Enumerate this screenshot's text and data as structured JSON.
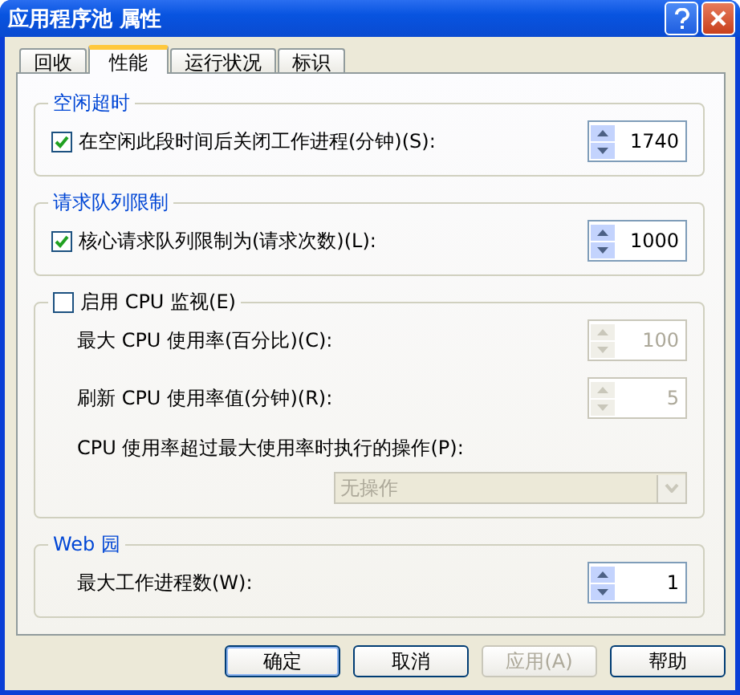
{
  "window": {
    "title": "应用程序池 属性"
  },
  "tabs": [
    {
      "label": "回收",
      "selected": false
    },
    {
      "label": "性能",
      "selected": true
    },
    {
      "label": "运行状况",
      "selected": false
    },
    {
      "label": "标识",
      "selected": false
    }
  ],
  "groups": [
    {
      "kind": "titled",
      "title": "空闲超时",
      "rows": [
        {
          "kind": "check-spin",
          "label": "在空闲此段时间后关闭工作进程(分钟)(S):",
          "checked": true,
          "value": "1740",
          "disabled": false
        }
      ]
    },
    {
      "kind": "titled",
      "title": "请求队列限制",
      "rows": [
        {
          "kind": "check-spin",
          "label": "核心请求队列限制为(请求次数)(L):",
          "checked": true,
          "value": "1000",
          "disabled": false
        }
      ]
    },
    {
      "kind": "check-titled",
      "title": "启用 CPU 监视(E)",
      "checked": false,
      "rows": [
        {
          "kind": "spin",
          "label": "最大 CPU 使用率(百分比)(C):",
          "value": "100",
          "disabled": true
        },
        {
          "kind": "spin",
          "label": "刷新 CPU 使用率值(分钟)(R):",
          "value": "5",
          "disabled": true
        },
        {
          "kind": "dropdown",
          "label": "CPU 使用率超过最大使用率时执行的操作(P):",
          "value": "无操作",
          "disabled": true
        }
      ]
    },
    {
      "kind": "titled",
      "title": "Web 园",
      "rows": [
        {
          "kind": "spin",
          "label": "最大工作进程数(W):",
          "value": "1",
          "disabled": false
        }
      ]
    }
  ],
  "buttons": [
    {
      "label": "确定",
      "default": true,
      "disabled": false
    },
    {
      "label": "取消",
      "default": false,
      "disabled": false
    },
    {
      "label": "应用(A)",
      "default": false,
      "disabled": true
    },
    {
      "label": "帮助",
      "default": false,
      "disabled": false
    }
  ]
}
